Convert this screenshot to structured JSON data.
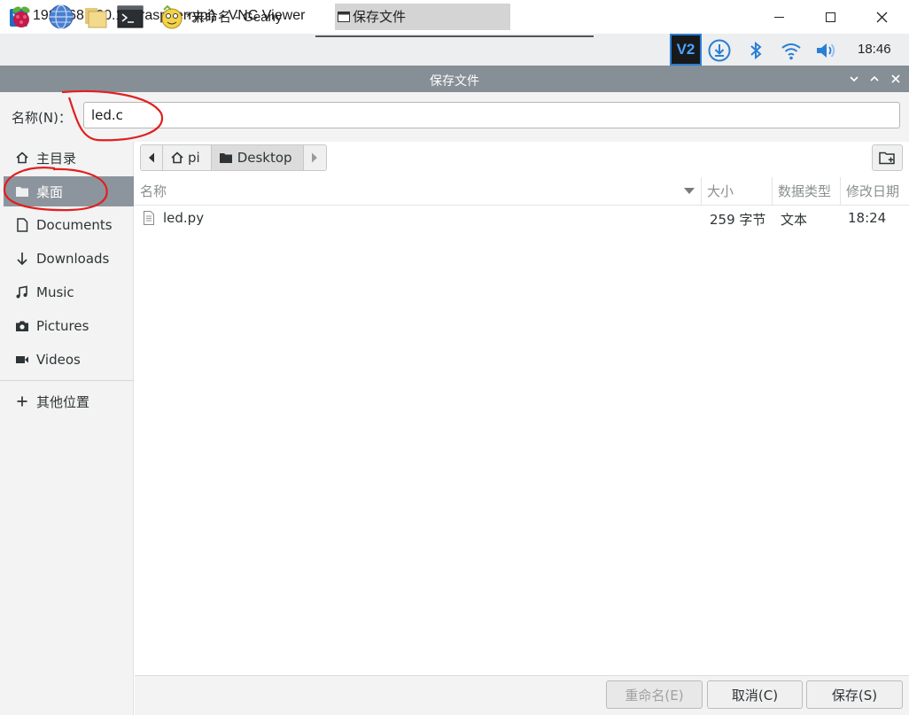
{
  "window": {
    "title": "192.168.120.10 (raspberrypi) - VNC Viewer",
    "logo_text": "V2"
  },
  "panel": {
    "task_geany": "*未命名 - Geany",
    "task_save": "保存文件",
    "tray_vnc_text": "V2",
    "clock": "18:46"
  },
  "dialog": {
    "title": "保存文件",
    "name_label": "名称(N)：",
    "name_value": "led.c"
  },
  "sidebar": {
    "items": [
      {
        "label": "主目录",
        "icon": "home-icon"
      },
      {
        "label": "桌面",
        "icon": "folder-icon",
        "selected": true
      },
      {
        "label": "Documents",
        "icon": "document-icon"
      },
      {
        "label": "Downloads",
        "icon": "download-arrow-icon"
      },
      {
        "label": "Music",
        "icon": "music-icon"
      },
      {
        "label": "Pictures",
        "icon": "camera-icon"
      },
      {
        "label": "Videos",
        "icon": "video-icon"
      }
    ],
    "other_locations": {
      "label": "其他位置",
      "icon": "plus-icon"
    }
  },
  "pathbar": {
    "segments": [
      "pi",
      "Desktop"
    ]
  },
  "filelist": {
    "columns": [
      "名称",
      "大小",
      "数据类型",
      "修改日期"
    ],
    "rows": [
      {
        "name": "led.py",
        "size": "259 字节",
        "type": "文本",
        "modified": "18:24"
      }
    ]
  },
  "buttons": {
    "rename": "重命名(E)",
    "cancel": "取消(C)",
    "save": "保存(S)"
  },
  "colors": {
    "selection": "#8c959d",
    "dialog_header": "#868e96",
    "annotation": "#e02020"
  }
}
